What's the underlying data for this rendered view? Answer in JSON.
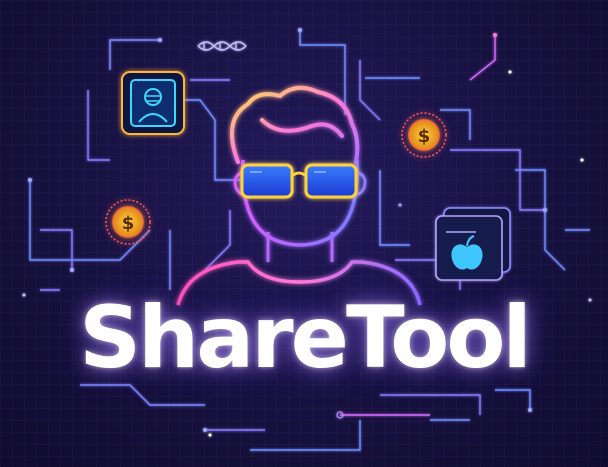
{
  "brand": {
    "name": "ShareTool"
  },
  "colors": {
    "background": "#15103a",
    "wordmark": "#ffffff",
    "circuit_blue": "#6f8cff",
    "circuit_pink": "#d36bff",
    "neon_yellow": "#ffd23a",
    "neon_pink": "#ff4fd8",
    "neon_cyan": "#3fd6ff",
    "glasses_blue": "#2f6bff"
  },
  "icons": [
    "person-avatar-icon",
    "profile-card-icon",
    "dollar-coin-icon",
    "apple-file-icon",
    "dna-helix-icon"
  ]
}
